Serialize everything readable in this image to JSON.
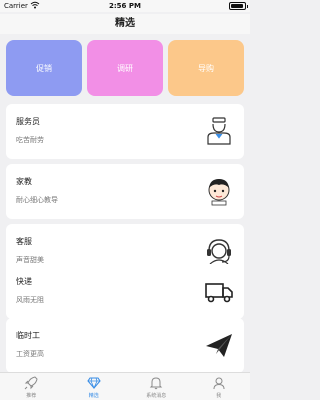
{
  "status_bar": {
    "carrier": "Carrier",
    "time": "2:56 PM"
  },
  "header": {
    "title": "精选"
  },
  "categories": [
    {
      "label": "促销",
      "color": "#8e9bf2"
    },
    {
      "label": "调研",
      "color": "#f28fe6"
    },
    {
      "label": "导购",
      "color": "#fcc88a"
    }
  ],
  "cards": [
    {
      "title": "服务员",
      "subtitle": "吃苦耐劳",
      "icon": "waiter-icon"
    },
    {
      "title": "家教",
      "subtitle": "耐心细心教导",
      "icon": "tutor-icon"
    },
    {
      "title": "客服",
      "subtitle": "声音甜美",
      "icon": "headset-icon"
    },
    {
      "title": "快递",
      "subtitle": "风雨无阻",
      "icon": "truck-icon"
    },
    {
      "title": "临时工",
      "subtitle": "工资更高",
      "icon": "paper-plane-icon"
    }
  ],
  "tabbar": {
    "active_color": "#3a8ee6",
    "items": [
      {
        "label": "推荐",
        "icon": "rocket-icon"
      },
      {
        "label": "精选",
        "icon": "diamond-icon",
        "active": true
      },
      {
        "label": "系统消息",
        "icon": "bell-icon"
      },
      {
        "label": "我",
        "icon": "user-icon"
      }
    ]
  }
}
